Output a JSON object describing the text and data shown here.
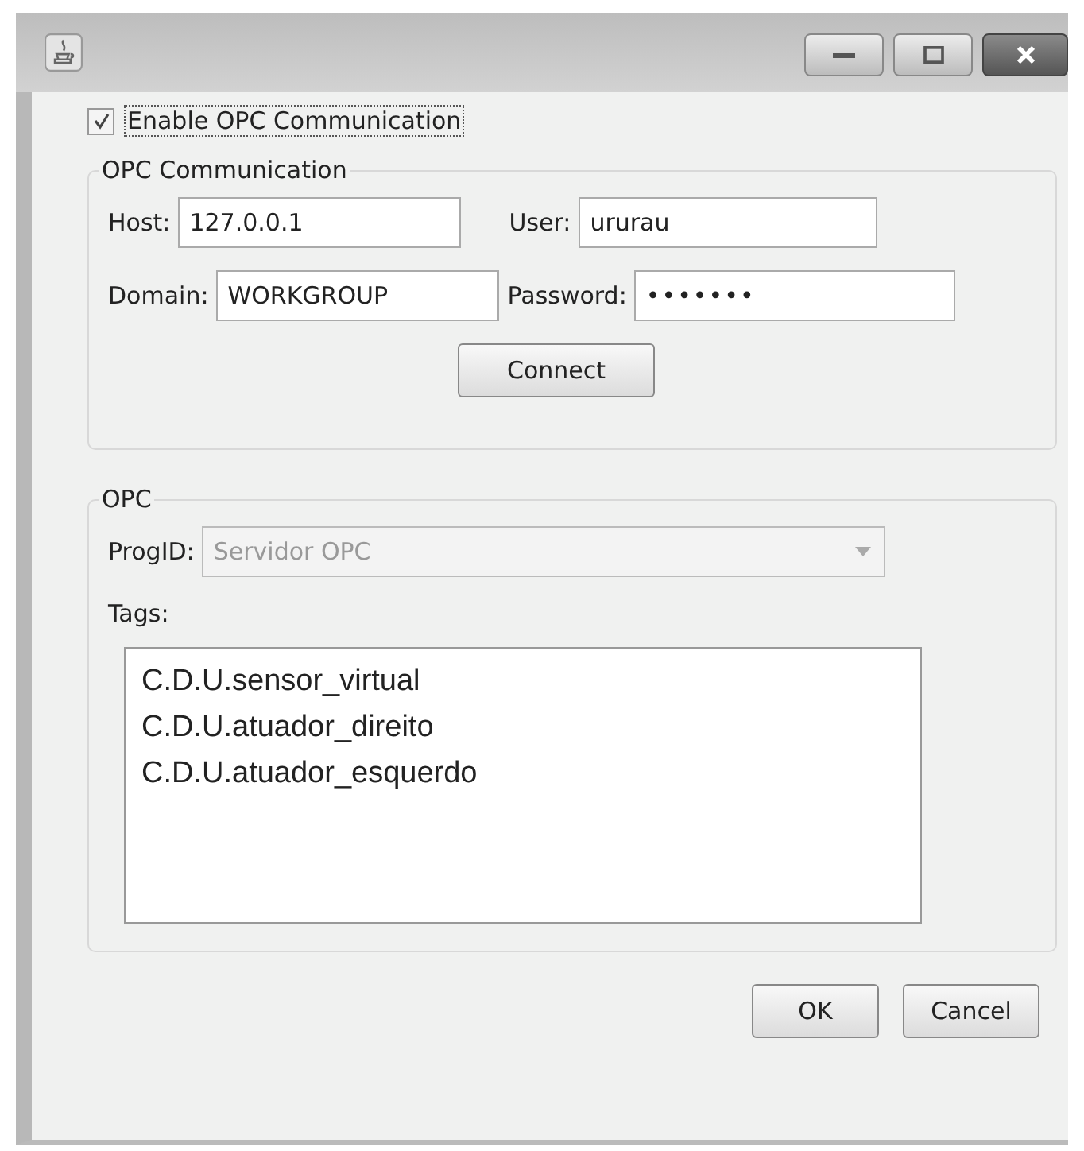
{
  "enable": {
    "label": "Enable OPC Communication",
    "checked": true
  },
  "communication": {
    "title": "OPC Communication",
    "fields": [
      {
        "label": "Host:",
        "value": "127.0.0.1"
      },
      {
        "label": "User:",
        "value": "ururau"
      },
      {
        "label": "Domain:",
        "value": "WORKGROUP"
      },
      {
        "label": "Password:",
        "value": "•••••••"
      }
    ],
    "button": "Connect"
  },
  "opc": {
    "title": "OPC",
    "progid": {
      "label": "ProgID:",
      "value": "Servidor OPC",
      "disabled": true
    },
    "tags_label": "Tags:",
    "tags": [
      "C.D.U.sensor_virtual",
      "C.D.U.atuador_direito",
      "C.D.U.atuador_esquerdo"
    ]
  },
  "buttons": [
    "OK",
    "Cancel"
  ]
}
